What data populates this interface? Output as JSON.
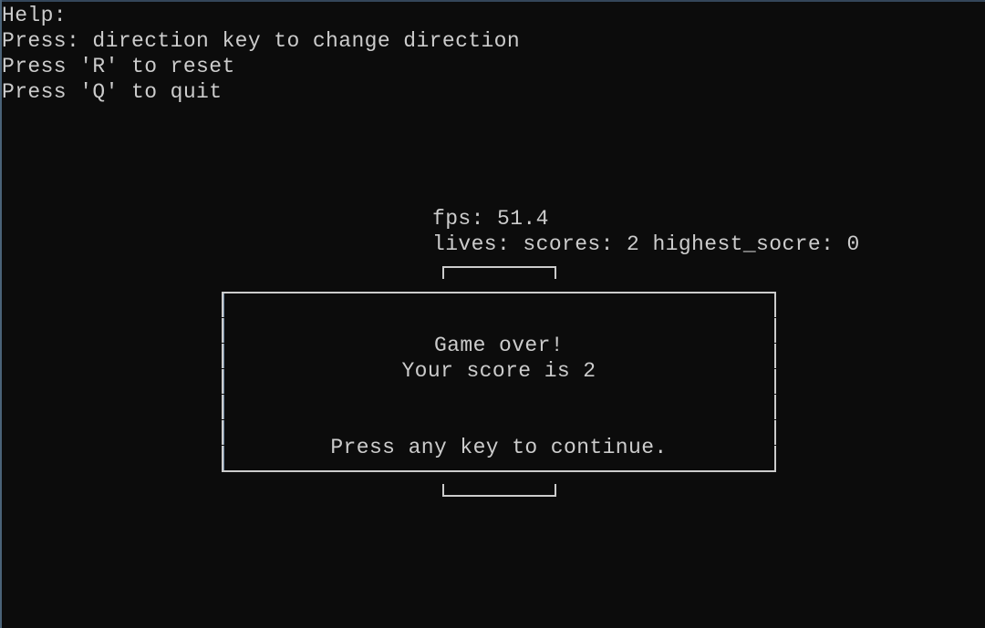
{
  "help": {
    "title": "Help:",
    "lines": [
      "Press: direction key to change direction",
      "Press 'R' to reset",
      "Press 'Q' to quit"
    ]
  },
  "hud": {
    "fps_line": "fps: 51.4",
    "status_line": "lives: scores: 2 highest_socre: 0",
    "fps": 51.4,
    "score": 2,
    "highest_score": 0
  },
  "dialog": {
    "title": "Game over!",
    "score_text": "Your score is 2",
    "prompt": "Press any key to continue."
  },
  "colors": {
    "background": "#0c0c0c",
    "text": "#cccccc"
  }
}
